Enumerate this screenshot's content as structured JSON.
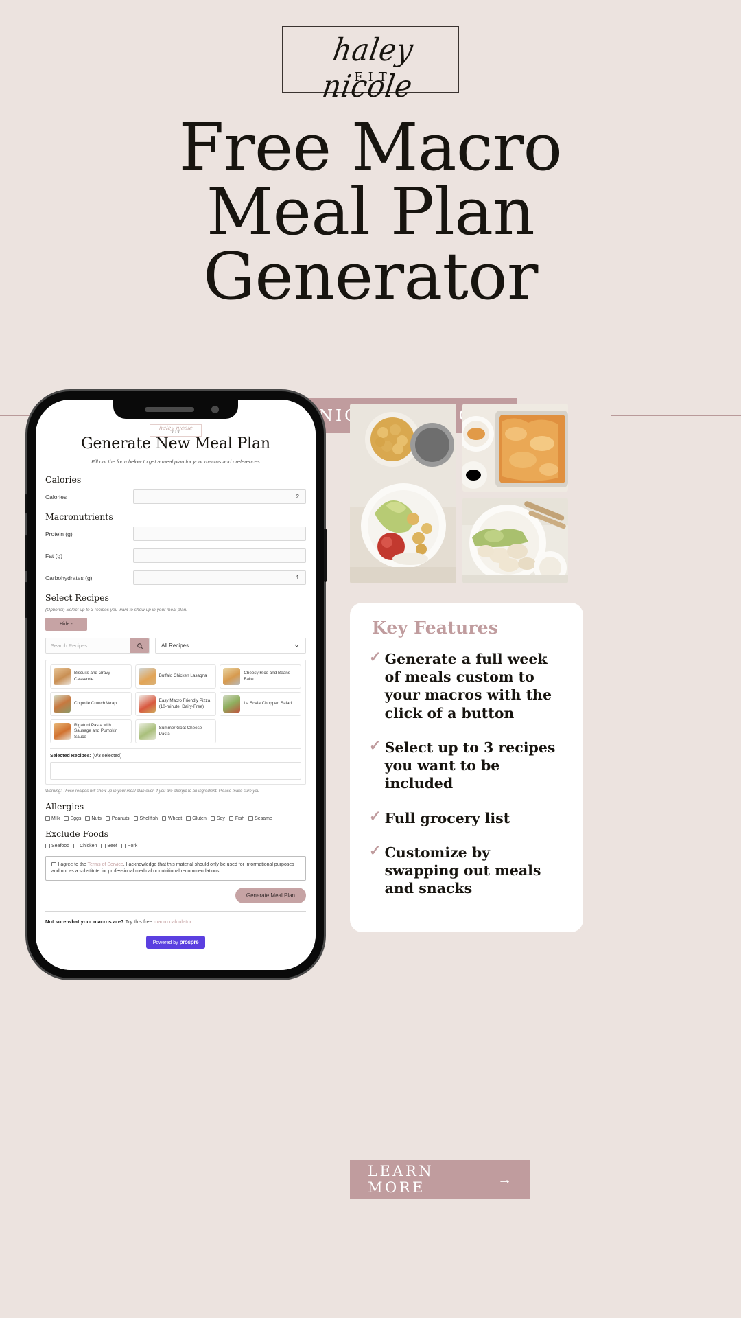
{
  "brand": {
    "script_name": "haley nicole",
    "sub_name": "FIT"
  },
  "hero": {
    "title_line1": "Free Macro",
    "title_line2": "Meal Plan",
    "title_line3": "Generator",
    "url_banner": "HALEYNICOLEFIT.COM"
  },
  "colors": {
    "background": "#ece3df",
    "accent_rose": "#c09c9e",
    "accent_rose_light": "#c6a3a4",
    "card_white": "#ffffff",
    "text_dark": "#17140f",
    "prospre_purple": "#5b3fe0"
  },
  "phone_app": {
    "logo_script": "haley nicole",
    "logo_fit": "FIT",
    "heading": "Generate New Meal Plan",
    "subheading": "Fill out the form below to get a meal plan for your macros and preferences",
    "sections": {
      "calories_heading": "Calories",
      "macros_heading": "Macronutrients",
      "recipes_heading": "Select Recipes",
      "allergies_heading": "Allergies",
      "exclude_heading": "Exclude Foods"
    },
    "fields": [
      {
        "label": "Calories",
        "value": "2"
      },
      {
        "label": "Protein (g)",
        "value": ""
      },
      {
        "label": "Fat (g)",
        "value": ""
      },
      {
        "label": "Carbohydrates (g)",
        "value": "1"
      }
    ],
    "recipes_note": "(Optional) Select up to 3 recipes you want to show up in your meal plan.",
    "hide_button": "Hide -",
    "search_placeholder": "Search Recipes",
    "search_icon": "search-icon",
    "filter_value": "All Recipes",
    "recipes": [
      "Biscuits and Gravy Casserole",
      "Buffalo Chicken Lasagna",
      "Cheesy Rice and Beans Bake",
      "Chipotle Crunch Wrap",
      "Easy Macro Friendly Pizza (10-minute, Dairy-Free)",
      "La Scala Chopped Salad",
      "Rigatoni Pasta with Sausage and Pumpkin Sauce",
      "Summer Goat Cheese Pasta"
    ],
    "selected_label": "Selected Recipes:",
    "selected_count": "(0/3 selected)",
    "warning": "Warning: These recipes will show up in your meal plan even if you are allergic to an ingredient. Please make sure you",
    "allergies": [
      "Milk",
      "Eggs",
      "Nuts",
      "Peanuts",
      "Shellfish",
      "Wheat",
      "Gluten",
      "Soy",
      "Fish",
      "Sesame"
    ],
    "exclude_foods": [
      "Seafood",
      "Chicken",
      "Beef",
      "Pork"
    ],
    "tos_prefix": "I agree to the ",
    "tos_link": "Terms of Service",
    "tos_suffix": ". I acknowledge that this material should only be used for informational purposes and not as a substitute for professional medical or nutritional recommendations.",
    "generate_button": "Generate Meal Plan",
    "footer_bold": "Not sure what your macros are?",
    "footer_text": " Try this free ",
    "footer_link": "macro calculator",
    "footer_period": ".",
    "powered_by": "Powered by ",
    "powered_brand": "prospre"
  },
  "key_features": {
    "title": "Key Features",
    "check_icon": "check-icon",
    "items": [
      "Generate a full week of meals custom to your macros with the click of a button",
      "Select up to 3 recipes you want to be included",
      "Full grocery list",
      "Customize by swapping out meals and snacks"
    ]
  },
  "cta": {
    "label": "LEARN MORE",
    "arrow": "→"
  }
}
